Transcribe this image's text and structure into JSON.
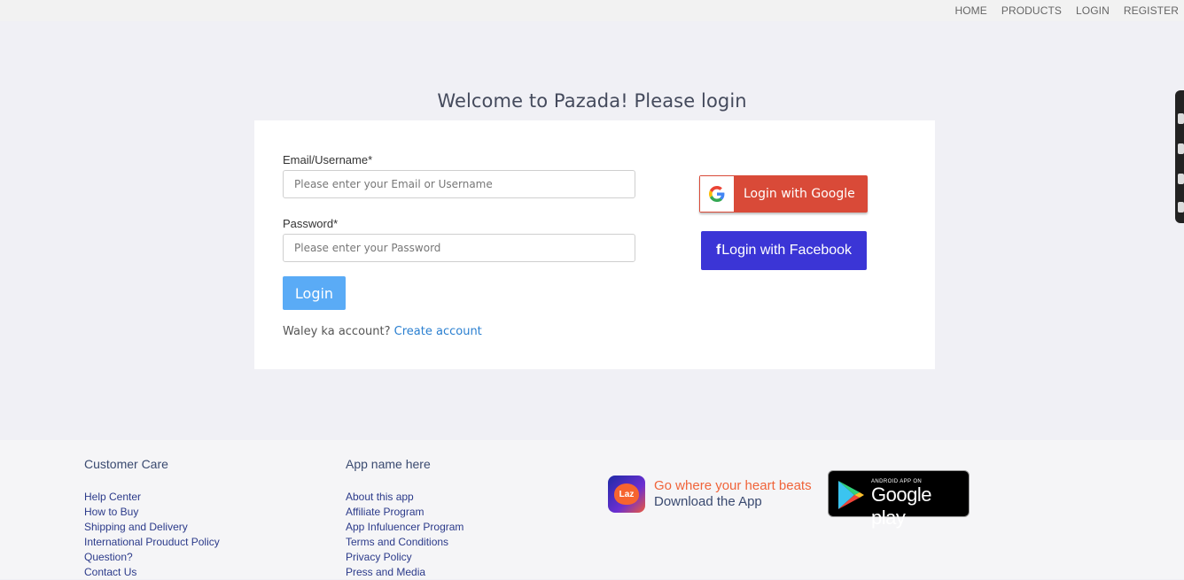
{
  "nav": {
    "home": "HOME",
    "products": "PRODUCTS",
    "login": "LOGIN",
    "register": "REGISTER"
  },
  "page": {
    "title": "Welcome to Pazada! Please login"
  },
  "form": {
    "email_label": "Email/Username*",
    "email_placeholder": "Please enter your Email or Username",
    "email_value": "",
    "password_label": "Password*",
    "password_placeholder": "Please enter your Password",
    "password_value": "",
    "login_button": "Login",
    "no_account_text": "Waley ka account?",
    "create_account_link": "Create account"
  },
  "social": {
    "google_button": "Login with Google",
    "facebook_icon_glyph": "f",
    "facebook_button": "Login with Facebook"
  },
  "footer": {
    "customer_care": {
      "title": "Customer Care",
      "links": [
        "Help Center",
        "How to Buy",
        "Shipping and Delivery",
        "International Prouduct Policy",
        "Question?",
        "Contact Us"
      ]
    },
    "app_section": {
      "title": "App name here",
      "links": [
        "About this app",
        "Affiliate Program",
        "App Infuluencer Program",
        "Terms and Conditions",
        "Privacy Policy",
        "Press and Media"
      ]
    },
    "promo": {
      "app_icon_text": "Laz",
      "line1": "Go where your heart beats",
      "line2": "Download the App"
    },
    "google_play": {
      "small_text": "ANDROID APP ON",
      "big_text": "Google play"
    }
  },
  "colors": {
    "google_red": "#d94a38",
    "facebook_blue": "#3b35d6",
    "login_blue": "#5aabf6",
    "link_blue": "#2a7fd0",
    "promo_orange": "#f0643a"
  }
}
